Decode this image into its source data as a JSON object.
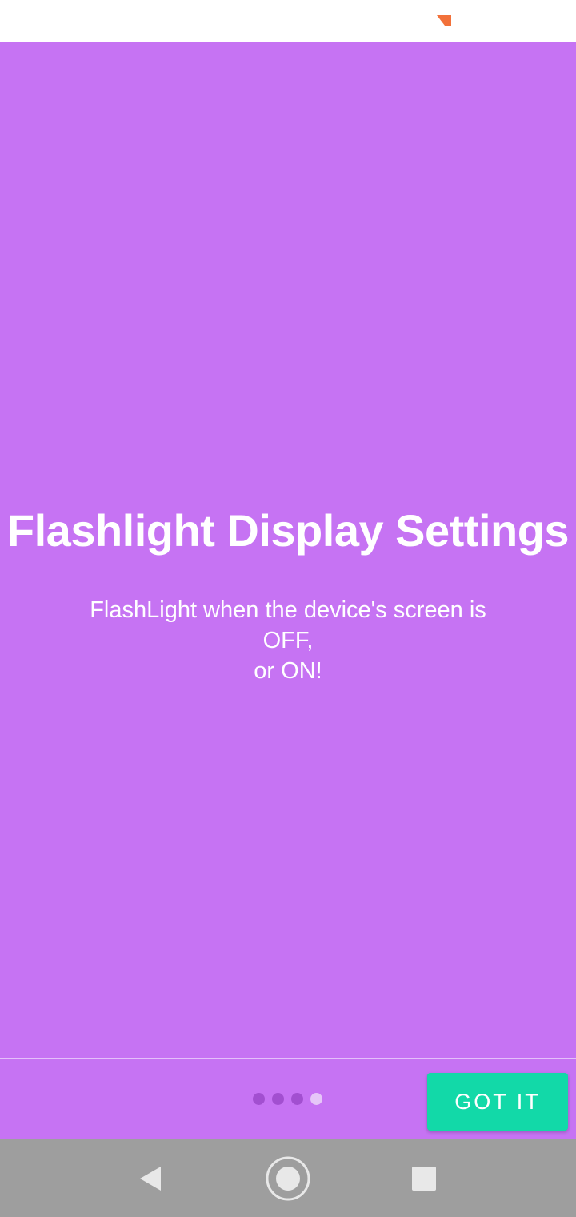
{
  "slide": {
    "title": "Flashlight Display Settings",
    "description_lines": [
      "FlashLight when the device's screen is",
      "OFF,",
      "or ON!"
    ],
    "background_color": "#C673F3"
  },
  "pager": {
    "total_pages": 4,
    "current_page": 4
  },
  "actions": {
    "got_it_label": "GOT IT",
    "got_it_color": "#12D9A8"
  },
  "status_bar": {
    "icon": "notification-flag-icon",
    "icon_color": "#F2713A"
  },
  "navigation": {
    "back_icon": "back-triangle-icon",
    "home_icon": "home-circle-icon",
    "recents_icon": "recents-square-icon"
  }
}
